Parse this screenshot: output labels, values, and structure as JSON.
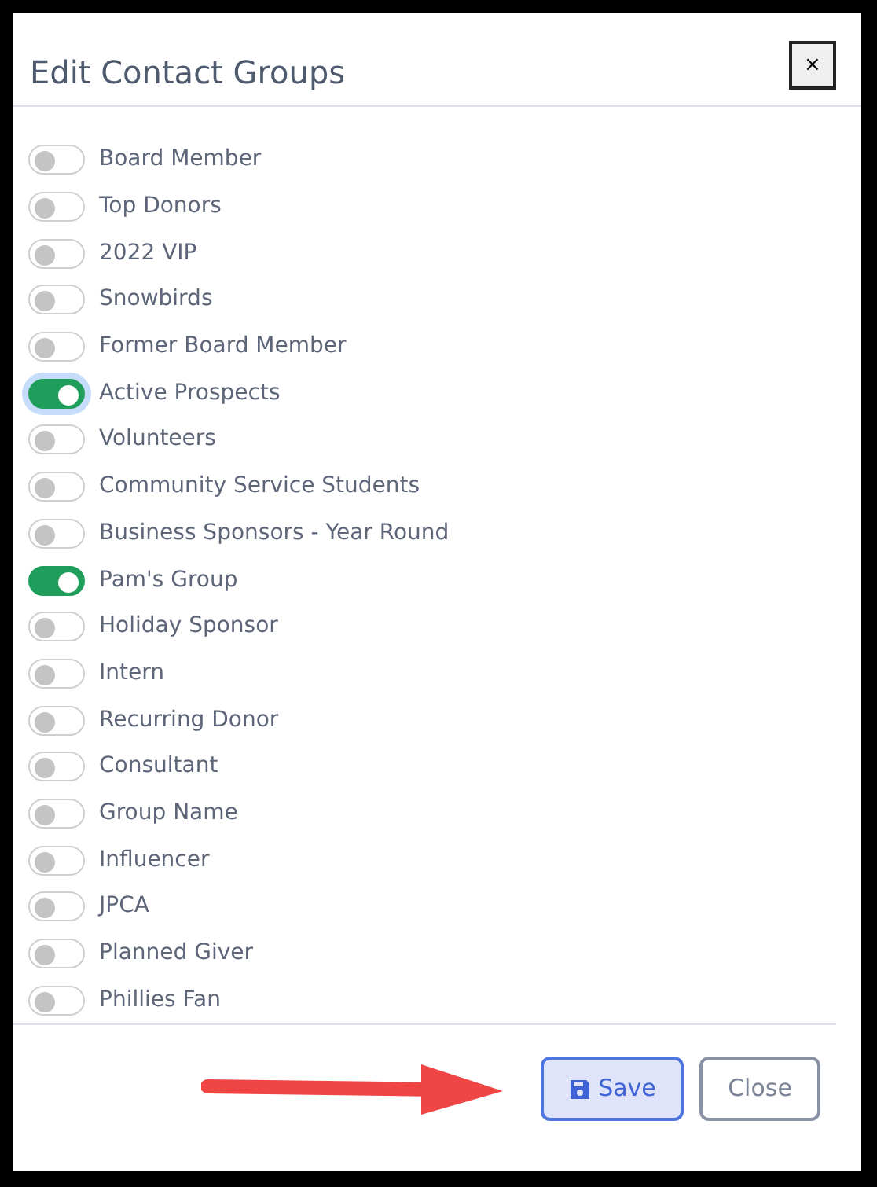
{
  "dialog": {
    "title": "Edit Contact Groups",
    "close_icon": "×"
  },
  "groups": [
    {
      "label": "Board Member",
      "checked": false,
      "focused": false
    },
    {
      "label": "Top Donors",
      "checked": false,
      "focused": false
    },
    {
      "label": "2022 VIP",
      "checked": false,
      "focused": false
    },
    {
      "label": "Snowbirds",
      "checked": false,
      "focused": false
    },
    {
      "label": "Former Board Member",
      "checked": false,
      "focused": false
    },
    {
      "label": "Active Prospects",
      "checked": true,
      "focused": true
    },
    {
      "label": "Volunteers",
      "checked": false,
      "focused": false
    },
    {
      "label": "Community Service Students",
      "checked": false,
      "focused": false
    },
    {
      "label": "Business Sponsors - Year Round",
      "checked": false,
      "focused": false
    },
    {
      "label": "Pam's Group",
      "checked": true,
      "focused": false
    },
    {
      "label": "Holiday Sponsor",
      "checked": false,
      "focused": false
    },
    {
      "label": "Intern",
      "checked": false,
      "focused": false
    },
    {
      "label": "Recurring Donor",
      "checked": false,
      "focused": false
    },
    {
      "label": "Consultant",
      "checked": false,
      "focused": false
    },
    {
      "label": "Group Name",
      "checked": false,
      "focused": false
    },
    {
      "label": "Influencer",
      "checked": false,
      "focused": false
    },
    {
      "label": "JPCA",
      "checked": false,
      "focused": false
    },
    {
      "label": "Planned Giver",
      "checked": false,
      "focused": false
    },
    {
      "label": "Phillies Fan",
      "checked": false,
      "focused": false
    }
  ],
  "buttons": [
    {
      "label": "Save",
      "kind": "primary"
    },
    {
      "label": "Close",
      "kind": "secondary"
    }
  ]
}
